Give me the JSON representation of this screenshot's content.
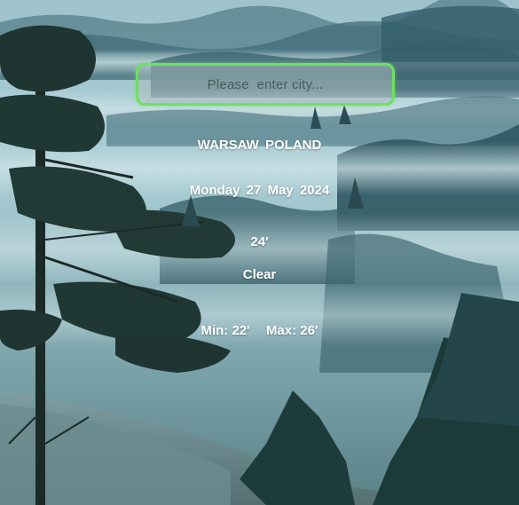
{
  "search": {
    "placeholder": "Please  enter city...",
    "value": ""
  },
  "weather": {
    "location": "WARSAW  POLAND",
    "date": "Monday  27  May  2024",
    "temperature": "24′",
    "condition": "Clear",
    "min": "Min: 22′",
    "max": "Max: 26′"
  },
  "colors": {
    "search_border": "#6be25f",
    "text": "#ffffff"
  }
}
